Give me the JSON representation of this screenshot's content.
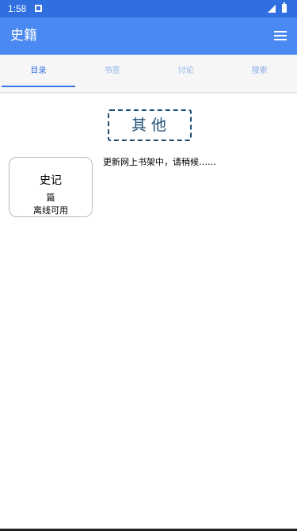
{
  "status_bar": {
    "time": "1:58",
    "icons": [
      "notification-icon",
      "signal-icon",
      "battery-icon"
    ]
  },
  "app_bar": {
    "title": "史籍",
    "menu_icon": "menu-icon",
    "color": "#4a88f2"
  },
  "tabs": [
    {
      "label": "目录",
      "active": true
    },
    {
      "label": "书签",
      "active": false
    },
    {
      "label": "讨论",
      "active": false
    },
    {
      "label": "搜索",
      "active": false
    }
  ],
  "section": {
    "title": "其他"
  },
  "book": {
    "title": "史记",
    "unit": "篇",
    "offline": "离线可用"
  },
  "update_message": "更新网上书架中，请稍候……"
}
